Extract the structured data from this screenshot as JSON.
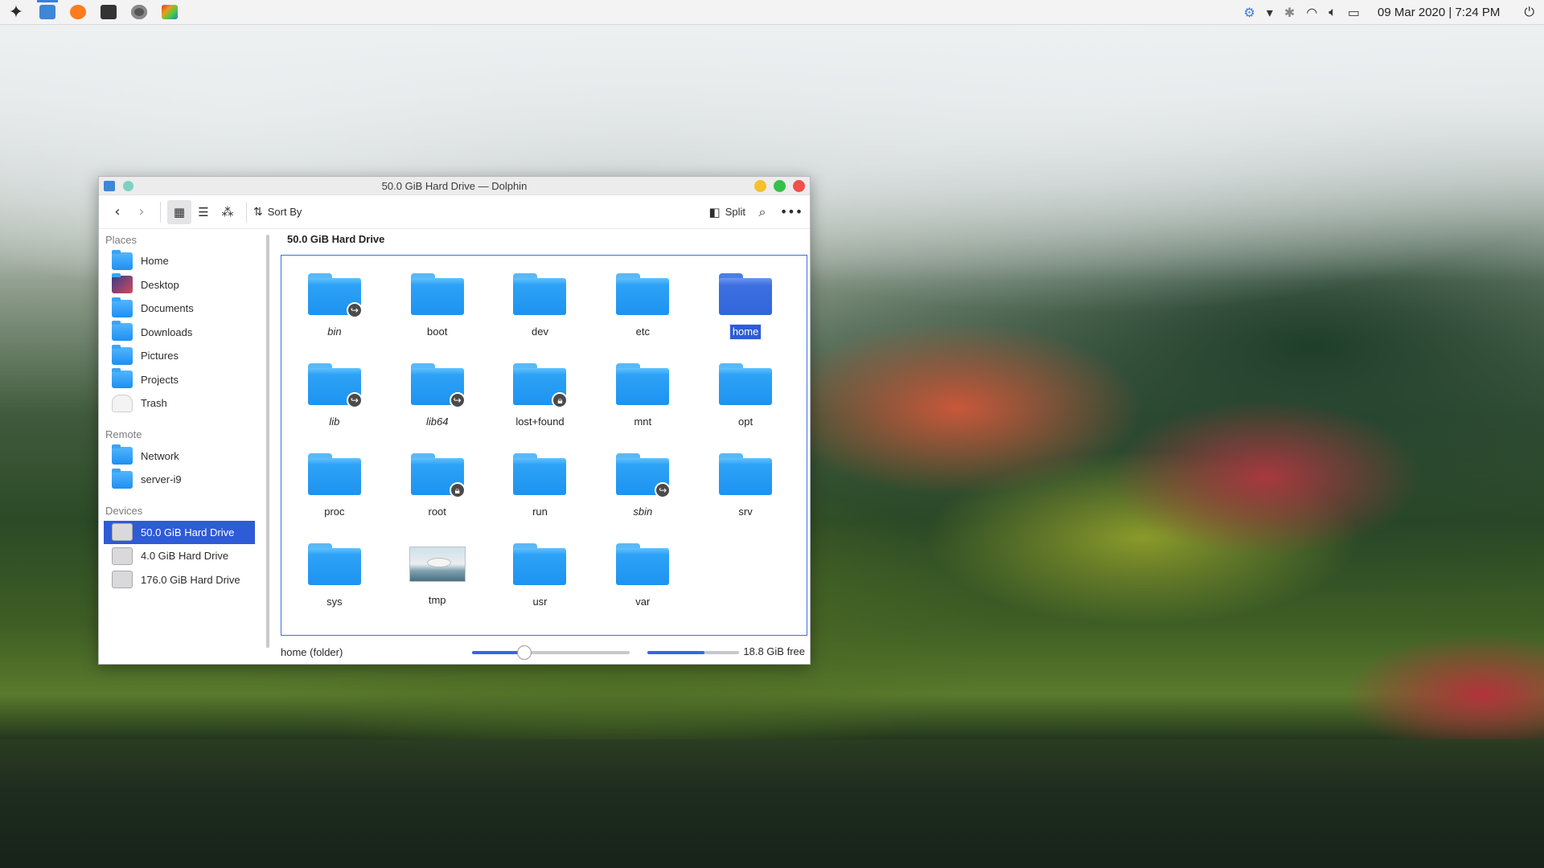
{
  "panel": {
    "clock": "09 Mar 2020 | 7:24 PM",
    "tasks": [
      {
        "name": "dolphin",
        "color": "#3e86d6",
        "active": true
      },
      {
        "name": "firefox",
        "color": "#ff7b1d"
      },
      {
        "name": "terminal",
        "color": "#333333"
      },
      {
        "name": "settings",
        "color": "#555555"
      },
      {
        "name": "color-picker",
        "color": "#e3a21a"
      }
    ]
  },
  "window": {
    "title": "50.0 GiB Hard Drive — Dolphin",
    "toolbar": {
      "sort_label": "Sort By",
      "split_label": "Split"
    },
    "sidebar": {
      "places_header": "Places",
      "places": [
        {
          "label": "Home",
          "icon": "home-folder"
        },
        {
          "label": "Desktop",
          "icon": "desktop-folder"
        },
        {
          "label": "Documents",
          "icon": "documents-folder"
        },
        {
          "label": "Downloads",
          "icon": "downloads-folder"
        },
        {
          "label": "Pictures",
          "icon": "pictures-folder"
        },
        {
          "label": "Projects",
          "icon": "projects-folder"
        },
        {
          "label": "Trash",
          "icon": "trash"
        }
      ],
      "remote_header": "Remote",
      "remote": [
        {
          "label": "Network",
          "icon": "network-folder"
        },
        {
          "label": "server-i9",
          "icon": "network-folder"
        }
      ],
      "devices_header": "Devices",
      "devices": [
        {
          "label": "50.0 GiB Hard Drive",
          "selected": true
        },
        {
          "label": "4.0 GiB Hard Drive"
        },
        {
          "label": "176.0 GiB Hard Drive"
        }
      ]
    },
    "breadcrumb": "50.0 GiB Hard Drive",
    "items": [
      {
        "name": "bin",
        "italic": true,
        "emblem": "link"
      },
      {
        "name": "boot"
      },
      {
        "name": "dev"
      },
      {
        "name": "etc"
      },
      {
        "name": "home",
        "selected": true
      },
      {
        "name": "lib",
        "italic": true,
        "emblem": "link"
      },
      {
        "name": "lib64",
        "italic": true,
        "emblem": "link"
      },
      {
        "name": "lost+found",
        "emblem": "lock"
      },
      {
        "name": "mnt"
      },
      {
        "name": "opt"
      },
      {
        "name": "proc"
      },
      {
        "name": "root",
        "emblem": "lock"
      },
      {
        "name": "run"
      },
      {
        "name": "sbin",
        "italic": true,
        "emblem": "link"
      },
      {
        "name": "srv"
      },
      {
        "name": "sys"
      },
      {
        "name": "tmp",
        "thumbnail": true
      },
      {
        "name": "usr"
      },
      {
        "name": "var"
      }
    ],
    "status": {
      "selection": "home (folder)",
      "zoom_fraction": 0.33,
      "used_fraction": 0.62,
      "free": "18.8 GiB free"
    }
  },
  "colors": {
    "accent": "#2e5bd6",
    "folder": "#1d93f1",
    "close": "#f0504a",
    "minimize": "#f5c02a",
    "maximize": "#35c04a"
  }
}
